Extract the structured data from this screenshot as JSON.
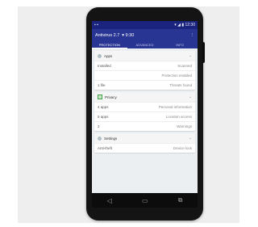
{
  "status_bar": {
    "left": "▪ ▪",
    "right": "▾ ◢ ▮ 12:30"
  },
  "app_bar": {
    "title": "Antivirus 2.7",
    "subtitle": "▾ 9:30",
    "menu_icon": "overflow-icon"
  },
  "tabs": [
    {
      "label": "PROTECTION",
      "active": true
    },
    {
      "label": "ADVANCED"
    },
    {
      "label": "INFO"
    }
  ],
  "cards": [
    {
      "title": "Apps",
      "rows": [
        {
          "label": "Installed",
          "value": "Scanned"
        },
        {
          "label": "",
          "value": "Protection enabled"
        },
        {
          "label": "1 file",
          "value": "Threats found"
        }
      ]
    },
    {
      "title": "Privacy",
      "rows": [
        {
          "label": "4 apps",
          "value": "Personal information"
        },
        {
          "label": "5 apps",
          "value": "Location access"
        },
        {
          "label": "2",
          "value": "Warnings"
        }
      ]
    },
    {
      "title": "Settings",
      "rows": [
        {
          "label": "Anti-theft",
          "value": "Device lock"
        }
      ]
    }
  ],
  "nav": {
    "back": "◁",
    "home": "▭",
    "recent": "⧉"
  },
  "colors": {
    "primary": "#283593",
    "status": "#1a237e",
    "check": "#43a047"
  }
}
